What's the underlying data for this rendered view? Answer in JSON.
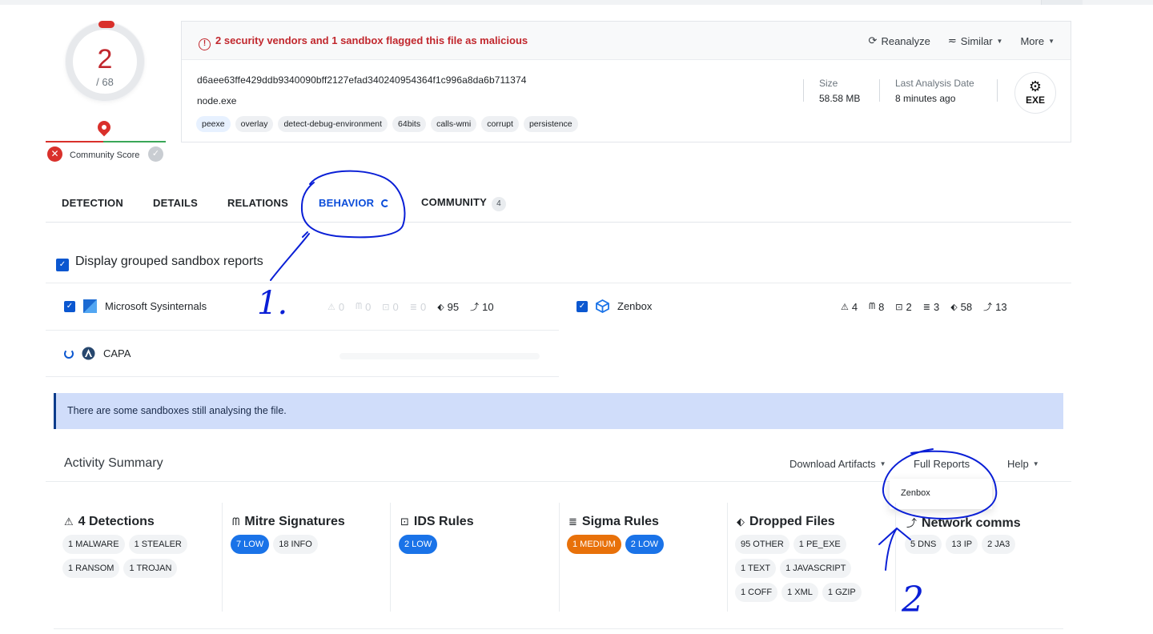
{
  "score": {
    "detections": "2",
    "total": "/ 68",
    "community_label": "Community Score"
  },
  "header": {
    "alert": "2 security vendors and 1 sandbox flagged this file as malicious",
    "actions": {
      "reanalyze": "Reanalyze",
      "similar": "Similar",
      "more": "More"
    },
    "hash": "d6aee63ffe429ddb9340090bff2127efad340240954364f1c996a8da6b711374",
    "filename": "node.exe",
    "tags": [
      "peexe",
      "overlay",
      "detect-debug-environment",
      "64bits",
      "calls-wmi",
      "corrupt",
      "persistence"
    ],
    "size_label": "Size",
    "size_value": "58.58 MB",
    "date_label": "Last Analysis Date",
    "date_value": "8 minutes ago",
    "filetype": "EXE"
  },
  "tabs": {
    "detection": "DETECTION",
    "details": "DETAILS",
    "relations": "RELATIONS",
    "behavior": "BEHAVIOR",
    "community": "COMMUNITY",
    "community_count": "4"
  },
  "grouped_label": "Display grouped sandbox reports",
  "sandboxes": {
    "sysinternals": {
      "name": "Microsoft Sysinternals",
      "stats": [
        "0",
        "0",
        "0",
        "0",
        "95",
        "10"
      ]
    },
    "zenbox": {
      "name": "Zenbox",
      "stats": [
        "4",
        "8",
        "2",
        "3",
        "58",
        "13"
      ]
    },
    "capa": {
      "name": "CAPA"
    }
  },
  "notice": "There are some sandboxes still analysing the file.",
  "activity": {
    "title": "Activity Summary",
    "download": "Download Artifacts",
    "full_reports": "Full Reports",
    "help": "Help",
    "dropdown_item": "Zenbox"
  },
  "columns": {
    "detections": {
      "title": "4 Detections",
      "chips": [
        "1 MALWARE",
        "1 STEALER",
        "1 RANSOM",
        "1 TROJAN"
      ]
    },
    "mitre": {
      "title": "Mitre Signatures",
      "chips": [
        "7 LOW",
        "18 INFO"
      ]
    },
    "ids": {
      "title": "IDS Rules",
      "chips": [
        "2 LOW"
      ]
    },
    "sigma": {
      "title": "Sigma Rules",
      "chips": [
        "1 MEDIUM",
        "2 LOW"
      ]
    },
    "dropped": {
      "title": "Dropped Files",
      "chips": [
        "95 OTHER",
        "1 PE_EXE",
        "1 TEXT",
        "1 JAVASCRIPT",
        "1 COFF",
        "1 XML",
        "1 GZIP"
      ]
    },
    "network": {
      "title": "Network comms",
      "chips": [
        "5 DNS",
        "13 IP",
        "2 JA3"
      ]
    }
  },
  "annotations": {
    "label_1": "1.",
    "label_2": "2"
  },
  "colors": {
    "malicious": "#c1272d",
    "accent": "#0b4dda",
    "annotation_ink": "#0a1fd6",
    "notice_bg": "#d0ddfa"
  }
}
